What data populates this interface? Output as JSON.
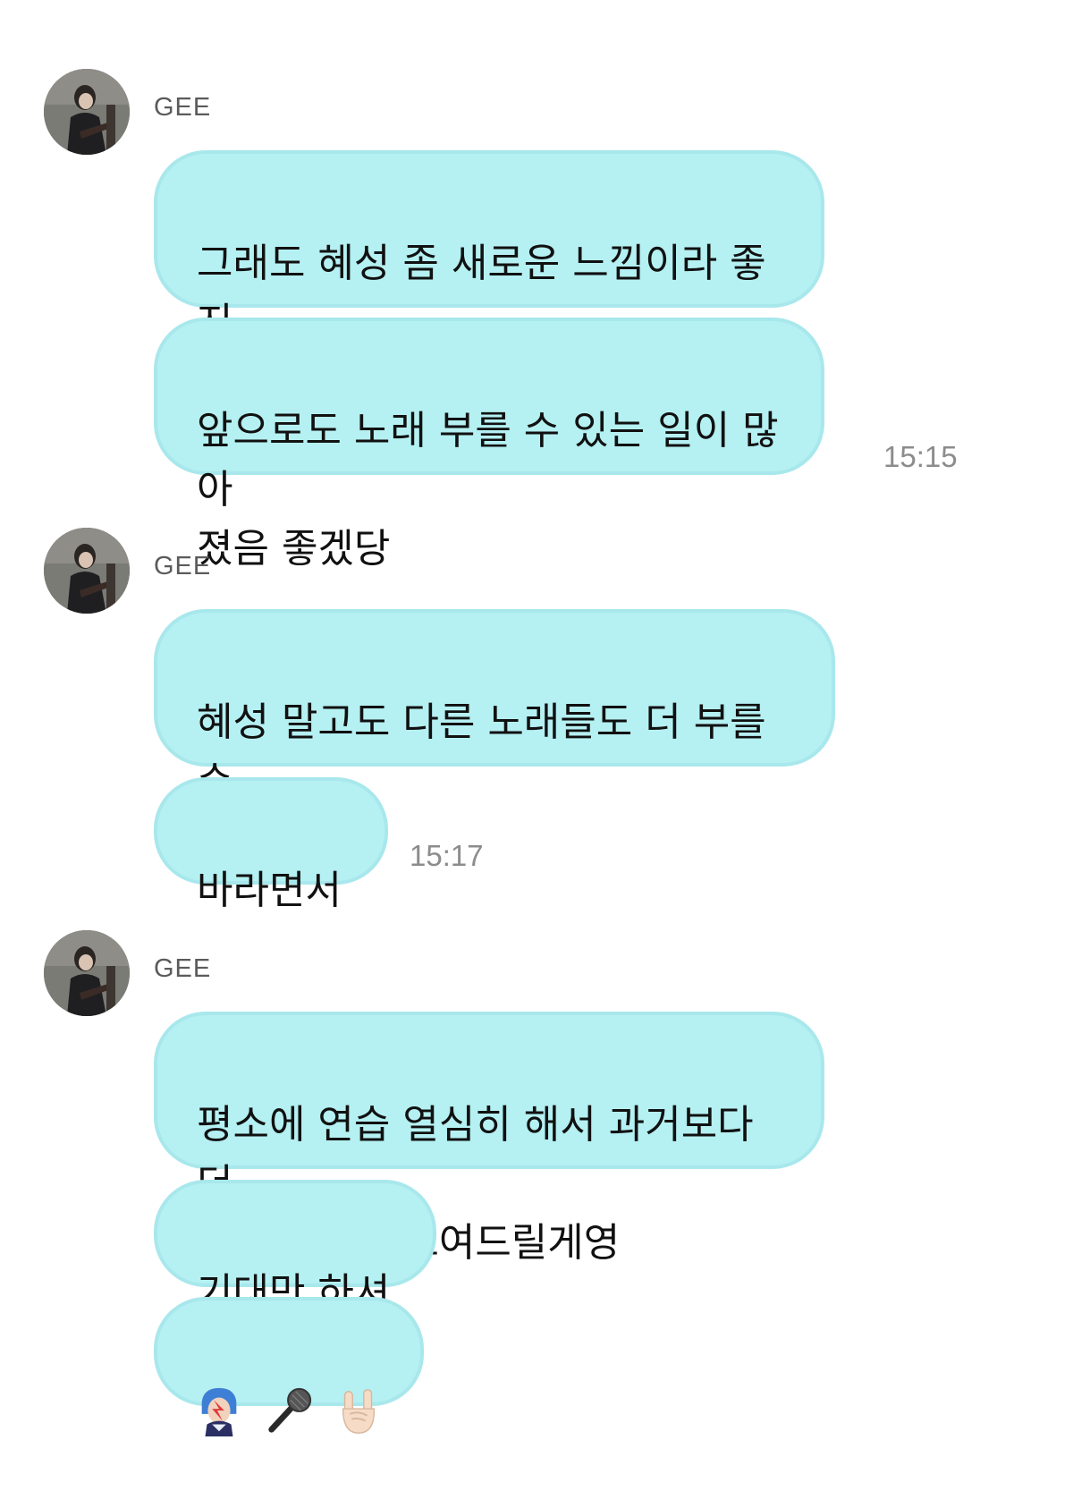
{
  "groups": [
    {
      "sender": "GEE",
      "messages": [
        "그래도 혜성 좀 새로운 느낌이라 좋지\n않았어??",
        "앞으로도 노래 부를 수 있는 일이 많아\n졌음 좋겠당"
      ],
      "time": "15:15"
    },
    {
      "sender": "GEE",
      "messages": [
        "혜성 말고도 다른 노래들도 더 부를 수\n있기를",
        "바라면서"
      ],
      "time": "15:17"
    },
    {
      "sender": "GEE",
      "messages": [
        "평소에 연습 열심히 해서 과거보다 더\n좋은 모습만 보여드릴게영",
        "기대만 하셔"
      ],
      "emojis": [
        "singer-emoji",
        "microphone-emoji",
        "sign-of-the-horns-emoji"
      ]
    }
  ],
  "colors": {
    "bubble": "#b5f0f2",
    "bubble_border": "#a8e8ec",
    "sender": "#5b5b5b",
    "time": "#8c8c8c"
  }
}
